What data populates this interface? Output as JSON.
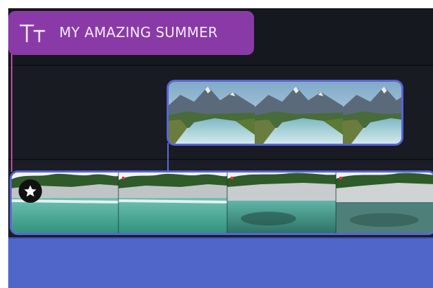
{
  "title_clip": {
    "label": "MY AMAZING SUMMER",
    "icon": "text-title-icon",
    "color": "#8a3aa6"
  },
  "overlay_clip": {
    "thumbnail_subject": "mountain-river-icon",
    "border_color": "#5864d6"
  },
  "main_clip": {
    "thumbnail_subject": "lake-cliff-icon",
    "badge_icon": "star-icon",
    "border_color": "#5864d6"
  },
  "bottom_track": {
    "color": "#5066c9"
  },
  "colors": {
    "timeline_bg": "#14161c",
    "accent_pink": "#c04aa0",
    "accent_blue": "#5a6be0"
  }
}
